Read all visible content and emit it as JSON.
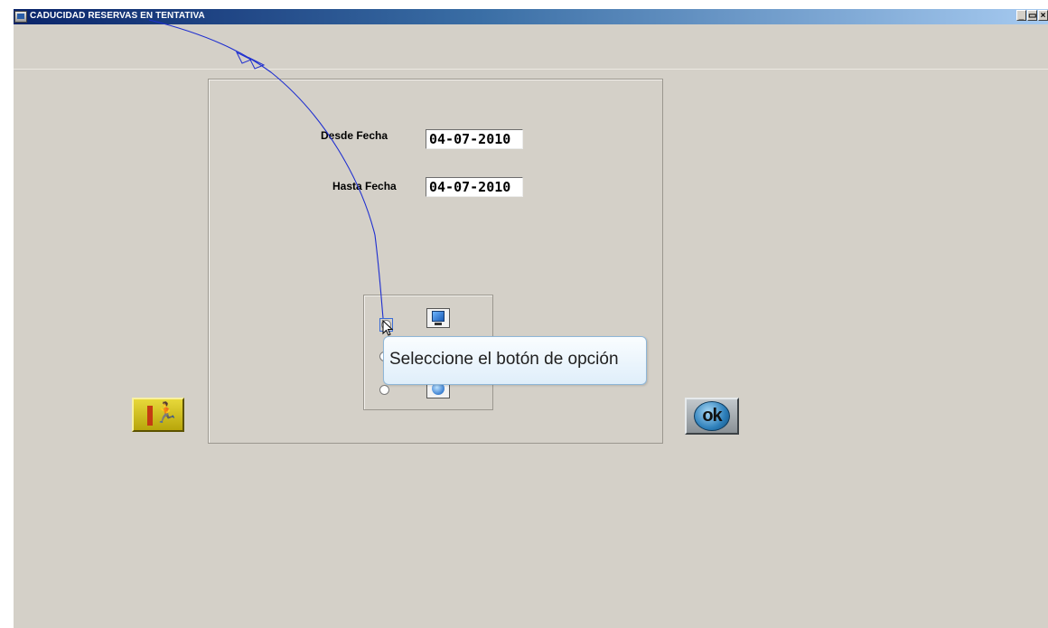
{
  "window": {
    "title": "CADUCIDAD RESERVAS EN TENTATIVA",
    "buttons": {
      "minimize": "_",
      "restore": "ͦ",
      "close": "×"
    }
  },
  "form": {
    "desde_label": "Desde Fecha",
    "desde_value": "04-07-2010",
    "hasta_label": "Hasta Fecha",
    "hasta_value": "04-07-2010"
  },
  "options": {
    "items": [
      {
        "icon": "monitor-icon",
        "selected": false
      },
      {
        "icon": "printer-icon",
        "selected": false
      },
      {
        "icon": "disc-icon",
        "selected": false
      }
    ]
  },
  "tooltip": {
    "text": "Seleccione el botón de opción"
  },
  "buttons": {
    "exit_icon": "exit-icon",
    "ok_label": "ok"
  },
  "colors": {
    "window_bg": "#d4d0c8",
    "titlebar_start": "#0a246a",
    "titlebar_end": "#a6caf0",
    "exit_button": "#d8c520",
    "trail": "#1f2fd0"
  }
}
